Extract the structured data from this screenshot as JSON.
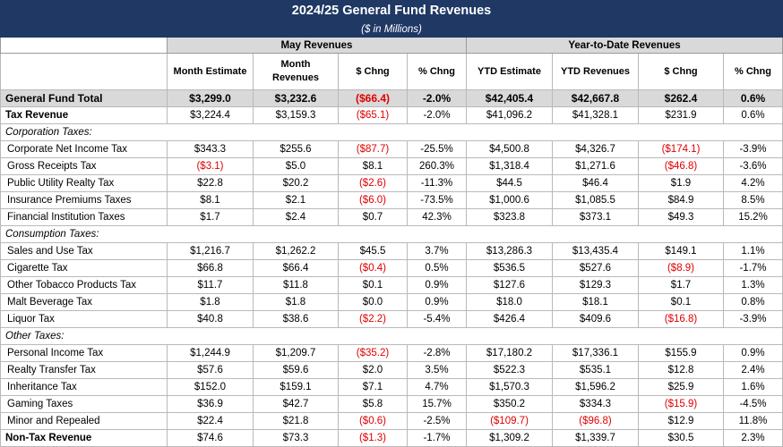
{
  "title": "2024/25 General Fund Revenues",
  "subtitle": "($ in Millions)",
  "groups": {
    "month": "May Revenues",
    "ytd": "Year-to-Date Revenues"
  },
  "headers": {
    "month_estimate": "Month Estimate",
    "month_revenues": "Month Revenues",
    "m_chng": "$ Chng",
    "m_pct": "% Chng",
    "ytd_estimate": "YTD Estimate",
    "ytd_revenues": "YTD Revenues",
    "y_chng": "$ Chng",
    "y_pct": "% Chng"
  },
  "rows": [
    {
      "type": "total",
      "label": "General Fund Total",
      "values": [
        "$3,299.0",
        "$3,232.6",
        "($66.4)",
        "-2.0%",
        "$42,405.4",
        "$42,667.8",
        "$262.4",
        "0.6%"
      ],
      "neg": [
        false,
        false,
        true,
        false,
        false,
        false,
        false,
        false
      ]
    },
    {
      "type": "bold",
      "label": "Tax Revenue",
      "values": [
        "$3,224.4",
        "$3,159.3",
        "($65.1)",
        "-2.0%",
        "$41,096.2",
        "$41,328.1",
        "$231.9",
        "0.6%"
      ],
      "neg": [
        false,
        false,
        true,
        false,
        false,
        false,
        false,
        false
      ]
    },
    {
      "type": "cat",
      "label": "Corporation Taxes:"
    },
    {
      "type": "item",
      "label": "Corporate Net Income Tax",
      "values": [
        "$343.3",
        "$255.6",
        "($87.7)",
        "-25.5%",
        "$4,500.8",
        "$4,326.7",
        "($174.1)",
        "-3.9%"
      ],
      "neg": [
        false,
        false,
        true,
        false,
        false,
        false,
        true,
        false
      ]
    },
    {
      "type": "item",
      "label": "Gross Receipts Tax",
      "values": [
        "($3.1)",
        "$5.0",
        "$8.1",
        "260.3%",
        "$1,318.4",
        "$1,271.6",
        "($46.8)",
        "-3.6%"
      ],
      "neg": [
        true,
        false,
        false,
        false,
        false,
        false,
        true,
        false
      ]
    },
    {
      "type": "item",
      "label": "Public Utility Realty Tax",
      "values": [
        "$22.8",
        "$20.2",
        "($2.6)",
        "-11.3%",
        "$44.5",
        "$46.4",
        "$1.9",
        "4.2%"
      ],
      "neg": [
        false,
        false,
        true,
        false,
        false,
        false,
        false,
        false
      ]
    },
    {
      "type": "item",
      "label": "Insurance Premiums Taxes",
      "values": [
        "$8.1",
        "$2.1",
        "($6.0)",
        "-73.5%",
        "$1,000.6",
        "$1,085.5",
        "$84.9",
        "8.5%"
      ],
      "neg": [
        false,
        false,
        true,
        false,
        false,
        false,
        false,
        false
      ]
    },
    {
      "type": "item",
      "label": "Financial Institution Taxes",
      "values": [
        "$1.7",
        "$2.4",
        "$0.7",
        "42.3%",
        "$323.8",
        "$373.1",
        "$49.3",
        "15.2%"
      ],
      "neg": [
        false,
        false,
        false,
        false,
        false,
        false,
        false,
        false
      ]
    },
    {
      "type": "cat",
      "label": "Consumption Taxes:"
    },
    {
      "type": "item",
      "label": "Sales and Use Tax",
      "values": [
        "$1,216.7",
        "$1,262.2",
        "$45.5",
        "3.7%",
        "$13,286.3",
        "$13,435.4",
        "$149.1",
        "1.1%"
      ],
      "neg": [
        false,
        false,
        false,
        false,
        false,
        false,
        false,
        false
      ]
    },
    {
      "type": "item",
      "label": "Cigarette Tax",
      "values": [
        "$66.8",
        "$66.4",
        "($0.4)",
        "0.5%",
        "$536.5",
        "$527.6",
        "($8.9)",
        "-1.7%"
      ],
      "neg": [
        false,
        false,
        true,
        false,
        false,
        false,
        true,
        false
      ]
    },
    {
      "type": "item",
      "label": "Other Tobacco Products Tax",
      "values": [
        "$11.7",
        "$11.8",
        "$0.1",
        "0.9%",
        "$127.6",
        "$129.3",
        "$1.7",
        "1.3%"
      ],
      "neg": [
        false,
        false,
        false,
        false,
        false,
        false,
        false,
        false
      ]
    },
    {
      "type": "item",
      "label": "Malt Beverage Tax",
      "values": [
        "$1.8",
        "$1.8",
        "$0.0",
        "0.9%",
        "$18.0",
        "$18.1",
        "$0.1",
        "0.8%"
      ],
      "neg": [
        false,
        false,
        false,
        false,
        false,
        false,
        false,
        false
      ]
    },
    {
      "type": "item",
      "label": "Liquor Tax",
      "values": [
        "$40.8",
        "$38.6",
        "($2.2)",
        "-5.4%",
        "$426.4",
        "$409.6",
        "($16.8)",
        "-3.9%"
      ],
      "neg": [
        false,
        false,
        true,
        false,
        false,
        false,
        true,
        false
      ]
    },
    {
      "type": "cat",
      "label": "Other Taxes:"
    },
    {
      "type": "item",
      "label": "Personal Income Tax",
      "values": [
        "$1,244.9",
        "$1,209.7",
        "($35.2)",
        "-2.8%",
        "$17,180.2",
        "$17,336.1",
        "$155.9",
        "0.9%"
      ],
      "neg": [
        false,
        false,
        true,
        false,
        false,
        false,
        false,
        false
      ]
    },
    {
      "type": "item",
      "label": "Realty Transfer Tax",
      "values": [
        "$57.6",
        "$59.6",
        "$2.0",
        "3.5%",
        "$522.3",
        "$535.1",
        "$12.8",
        "2.4%"
      ],
      "neg": [
        false,
        false,
        false,
        false,
        false,
        false,
        false,
        false
      ]
    },
    {
      "type": "item",
      "label": "Inheritance Tax",
      "values": [
        "$152.0",
        "$159.1",
        "$7.1",
        "4.7%",
        "$1,570.3",
        "$1,596.2",
        "$25.9",
        "1.6%"
      ],
      "neg": [
        false,
        false,
        false,
        false,
        false,
        false,
        false,
        false
      ]
    },
    {
      "type": "item",
      "label": "Gaming Taxes",
      "values": [
        "$36.9",
        "$42.7",
        "$5.8",
        "15.7%",
        "$350.2",
        "$334.3",
        "($15.9)",
        "-4.5%"
      ],
      "neg": [
        false,
        false,
        false,
        false,
        false,
        false,
        true,
        false
      ]
    },
    {
      "type": "item",
      "label": "Minor and Repealed",
      "values": [
        "$22.4",
        "$21.8",
        "($0.6)",
        "-2.5%",
        "($109.7)",
        "($96.8)",
        "$12.9",
        "11.8%"
      ],
      "neg": [
        false,
        false,
        true,
        false,
        true,
        true,
        false,
        false
      ]
    },
    {
      "type": "bold",
      "label": "Non-Tax Revenue",
      "values": [
        "$74.6",
        "$73.3",
        "($1.3)",
        "-1.7%",
        "$1,309.2",
        "$1,339.7",
        "$30.5",
        "2.3%"
      ],
      "neg": [
        false,
        false,
        true,
        false,
        false,
        false,
        false,
        false
      ]
    }
  ]
}
